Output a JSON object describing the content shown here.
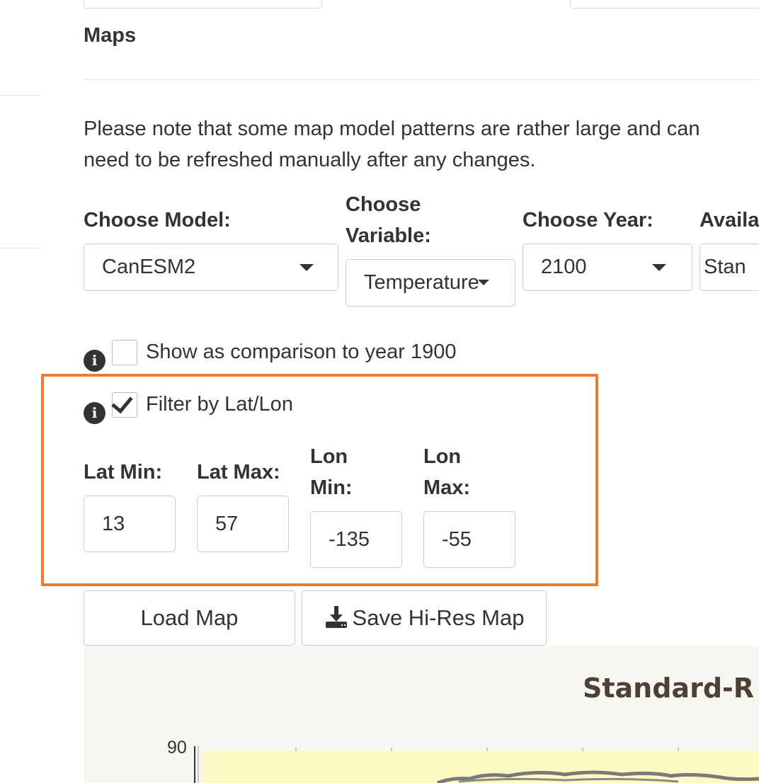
{
  "section": {
    "title": "Maps"
  },
  "note": {
    "line1": "Please note that some map model patterns are rather large and can",
    "line2": "need to be refreshed manually after any changes."
  },
  "controls": {
    "model": {
      "label": "Choose Model:",
      "value": "CanESM2"
    },
    "variable": {
      "label_line1": "Choose",
      "label_line2": "Variable:",
      "value": "Temperature"
    },
    "year": {
      "label": "Choose Year:",
      "value": "2100"
    },
    "available": {
      "label": "Availa",
      "value": "Stan"
    }
  },
  "options": {
    "compare": {
      "label": "Show as comparison to year 1900",
      "checked": false
    },
    "filter": {
      "label": "Filter by Lat/Lon",
      "checked": true
    }
  },
  "filter_fields": {
    "lat_min": {
      "label": "Lat Min:",
      "value": "13"
    },
    "lat_max": {
      "label": "Lat Max:",
      "value": "57"
    },
    "lon_min": {
      "label_line1": "Lon",
      "label_line2": "Min:",
      "value": "-135"
    },
    "lon_max": {
      "label_line1": "Lon",
      "label_line2": "Max:",
      "value": "-55"
    }
  },
  "buttons": {
    "load": "Load Map",
    "save": "Save Hi-Res Map"
  },
  "map": {
    "title": "Standard-R",
    "y_tick_top": "90"
  },
  "colors": {
    "highlight": "#f07a2a",
    "text": "#333333",
    "map_bg": "#f7f6f1",
    "plot_bg": "#fdf9c4"
  }
}
